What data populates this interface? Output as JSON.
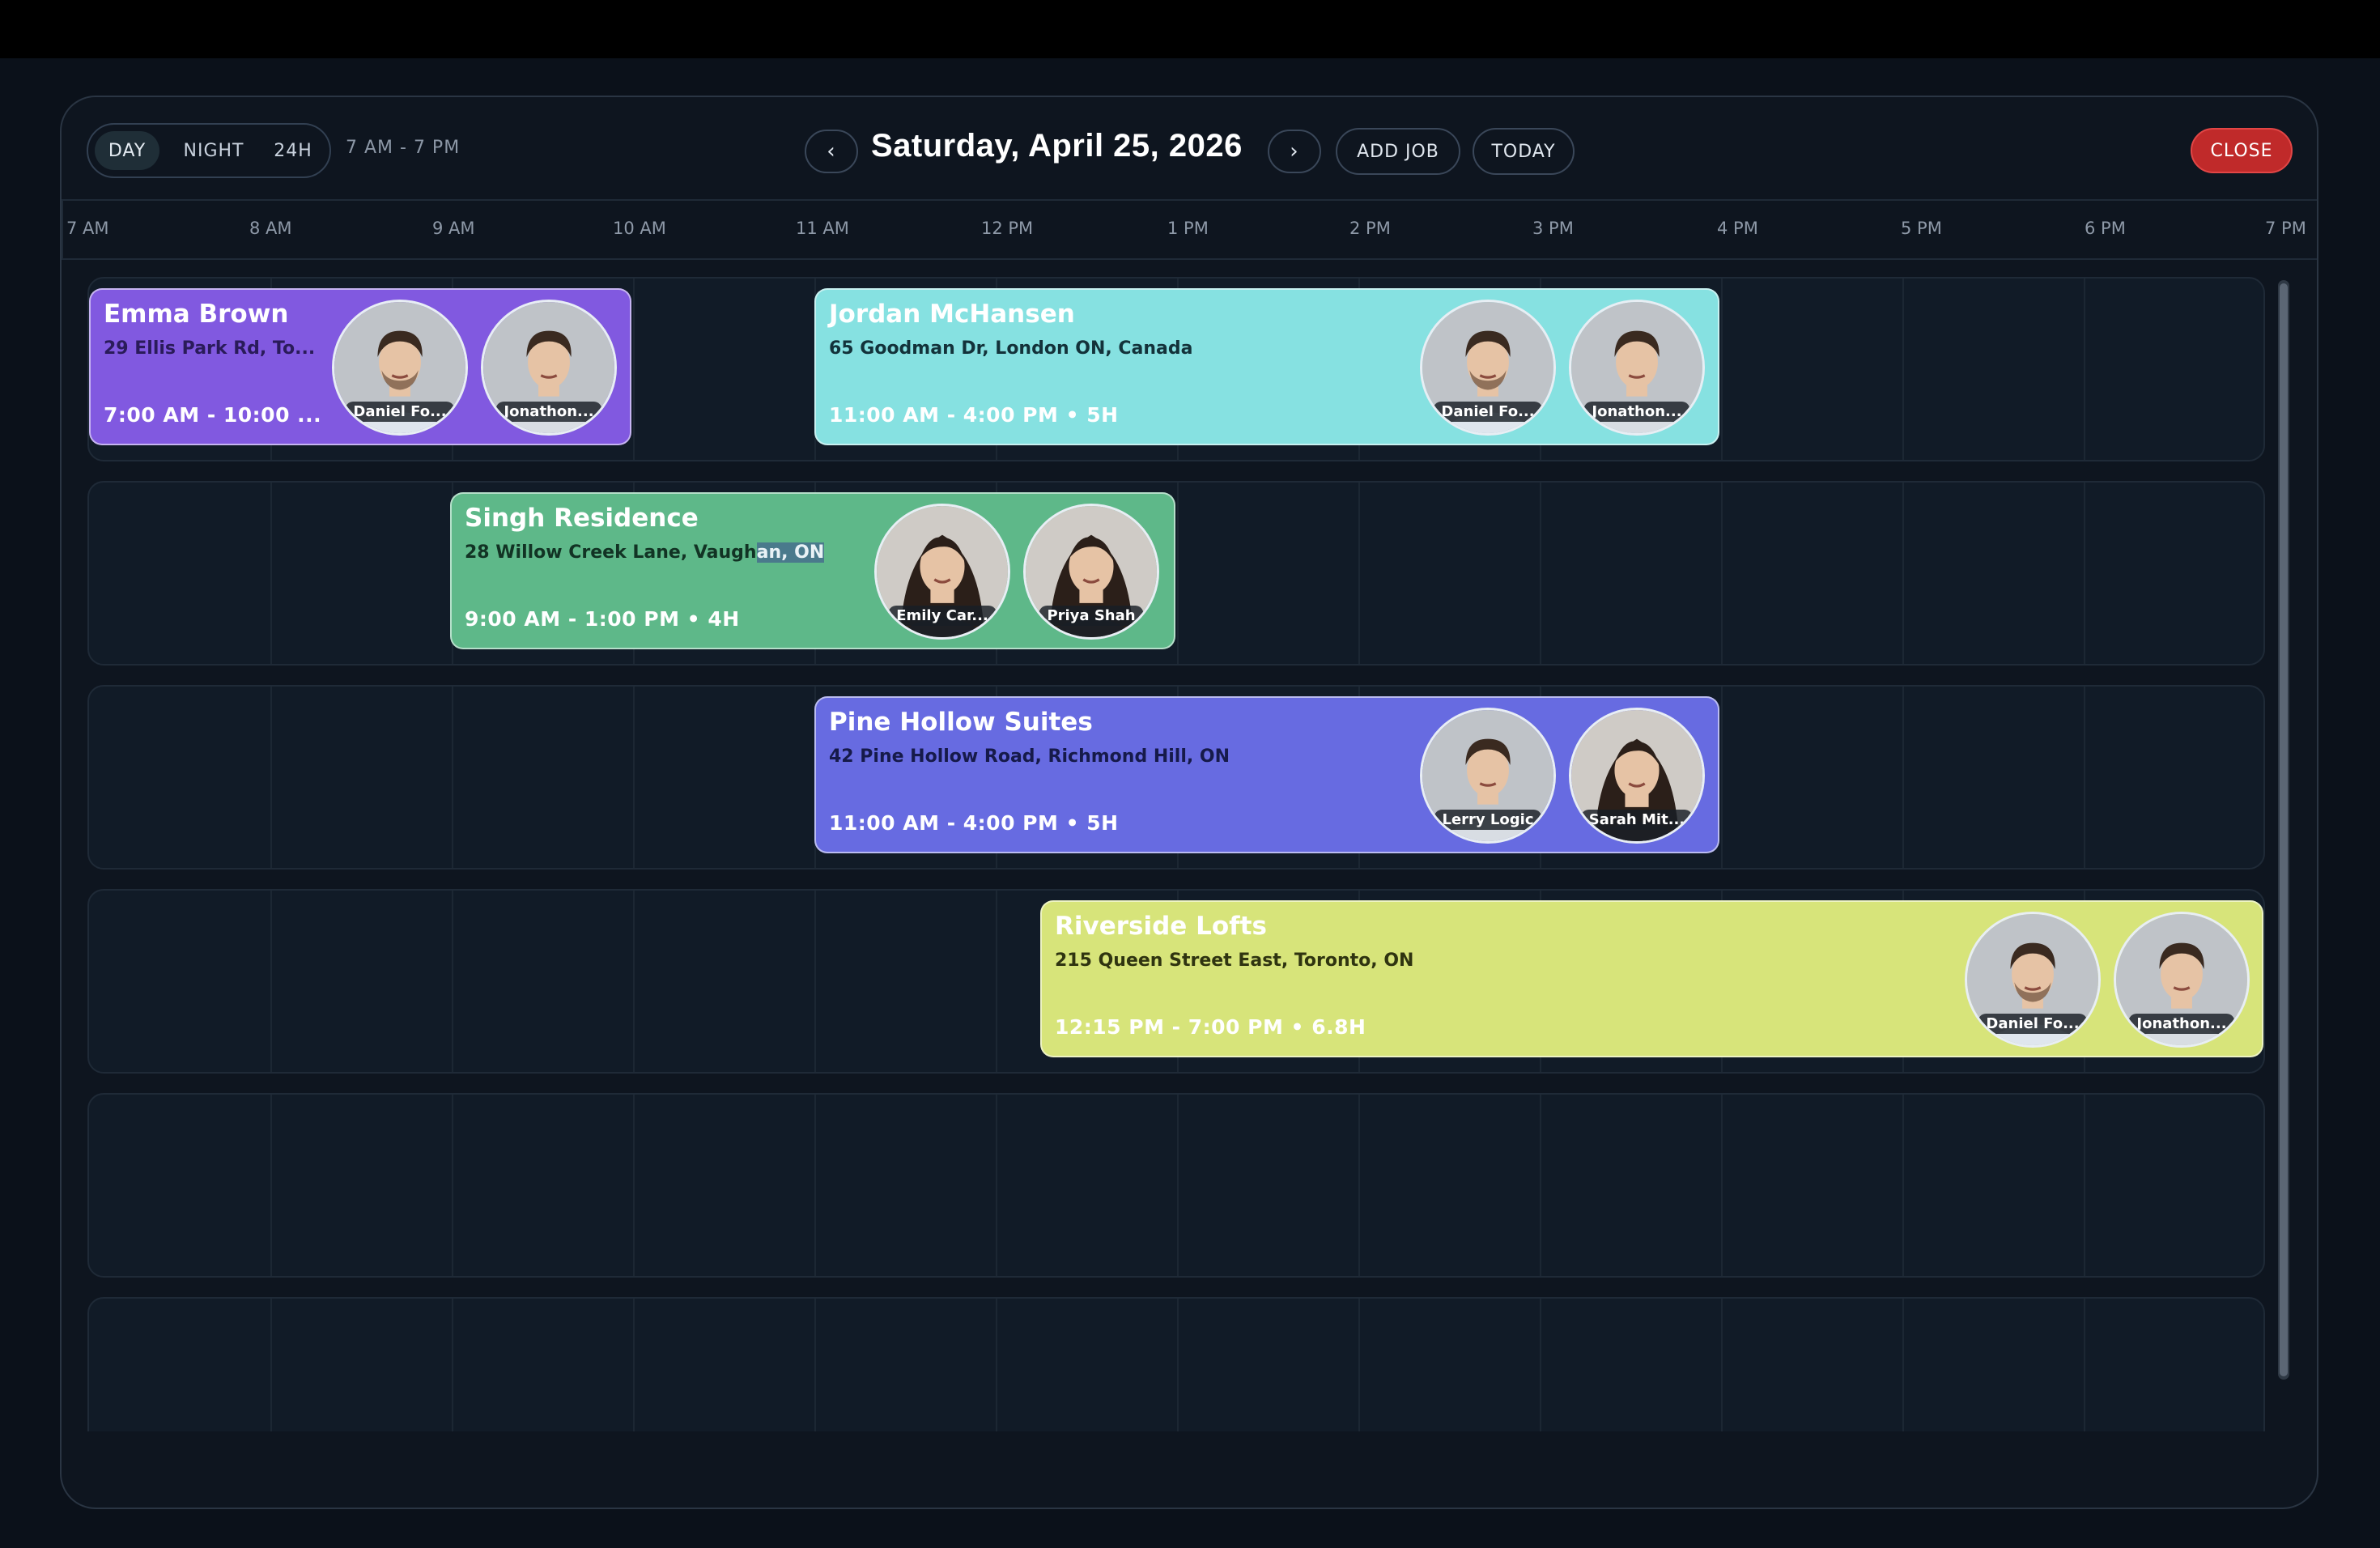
{
  "header": {
    "modes": [
      "DAY",
      "NIGHT",
      "24H"
    ],
    "active_mode": "DAY",
    "range": "7 AM - 7 PM",
    "prev_label": "‹",
    "next_label": "›",
    "date": "Saturday, April 25, 2026",
    "add_job_label": "ADD JOB",
    "today_label": "TODAY",
    "close_label": "CLOSE"
  },
  "timeline": {
    "hours": [
      "7 AM",
      "8 AM",
      "9 AM",
      "10 AM",
      "11 AM",
      "12 PM",
      "1 PM",
      "2 PM",
      "3 PM",
      "4 PM",
      "5 PM",
      "6 PM",
      "7 PM"
    ]
  },
  "jobs": [
    {
      "title": "Emma Brown",
      "address": "29 Ellis Park Rd, To...",
      "time": "7:00 AM - 10:00 ...",
      "color": "#8159e0",
      "address_color": "#2a1b5a",
      "staff": [
        {
          "name": "Daniel Fo...",
          "icon": "person-man-beard"
        },
        {
          "name": "Jonathon...",
          "icon": "person-man"
        }
      ]
    },
    {
      "title": "Jordan McHansen",
      "address": "65 Goodman Dr, London ON, Canada",
      "time": "11:00 AM - 4:00 PM • 5H",
      "color": "#86e1e1",
      "address_color": "#13323a",
      "staff": [
        {
          "name": "Daniel Fo...",
          "icon": "person-man-beard"
        },
        {
          "name": "Jonathon...",
          "icon": "person-man"
        }
      ]
    },
    {
      "title": "Singh Residence",
      "address_pre": "28 Willow Creek Lane, Vaugh",
      "address_highlight": "an, ON",
      "time": "9:00 AM - 1:00 PM • 4H",
      "color": "#5eb889",
      "address_color": "#123324",
      "staff": [
        {
          "name": "Emily Car...",
          "icon": "person-woman"
        },
        {
          "name": "Priya Shah",
          "icon": "person-woman"
        }
      ]
    },
    {
      "title": "Pine Hollow Suites",
      "address": "42 Pine Hollow Road, Richmond Hill, ON",
      "time": "11:00 AM - 4:00 PM • 5H",
      "color": "#676be1",
      "address_color": "#161a4a",
      "staff": [
        {
          "name": "Lerry Logic",
          "icon": "person-man"
        },
        {
          "name": "Sarah Mit...",
          "icon": "person-woman"
        }
      ]
    },
    {
      "title": "Riverside Lofts",
      "address": "215 Queen Street East, Toronto, ON",
      "time": "12:15 PM - 7:00 PM • 6.8H",
      "color": "#d7e47a",
      "address_color": "#2f3410",
      "staff": [
        {
          "name": "Daniel Fo...",
          "icon": "person-man-beard"
        },
        {
          "name": "Jonathon...",
          "icon": "person-man"
        }
      ]
    }
  ]
}
